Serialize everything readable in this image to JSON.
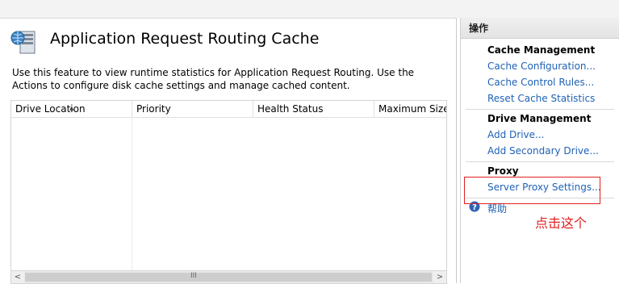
{
  "main": {
    "title": "Application Request Routing Cache",
    "description": "Use this feature to view runtime statistics for Application Request Routing.  Use the Actions to configure disk cache settings and manage cached content.",
    "columns": [
      "Drive Location",
      "Priority",
      "Health Status",
      "Maximum Size"
    ],
    "scroll_grip": "III",
    "scroll_left": "<",
    "scroll_right": ">"
  },
  "actions": {
    "header": "操作",
    "groups": [
      {
        "title": "Cache Management",
        "links": [
          "Cache Configuration...",
          "Cache Control Rules...",
          "Reset Cache Statistics"
        ]
      },
      {
        "title": "Drive Management",
        "links": [
          "Add Drive...",
          "Add Secondary Drive..."
        ]
      },
      {
        "title": "Proxy",
        "links": [
          "Server Proxy Settings..."
        ]
      }
    ],
    "help": "帮助"
  },
  "annotation": {
    "text": "点击这个",
    "color": "#e02020"
  },
  "colors": {
    "link": "#1e62b5",
    "panel_header": "#e8e8e8"
  }
}
